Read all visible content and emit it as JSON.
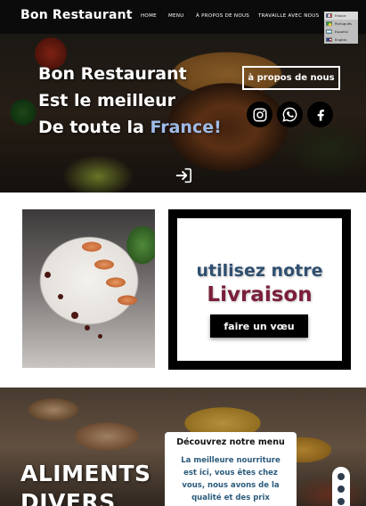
{
  "nav": {
    "brand": "Bon Restaurant",
    "links": [
      "HOME",
      "MENU",
      "À PROPOS DE NOUS",
      "TRAVAILLE AVEC NOUS"
    ],
    "languages": {
      "selected": "France",
      "options": [
        "Português",
        "Español",
        "English"
      ]
    }
  },
  "hero": {
    "line1": "Bon Restaurant",
    "line2": "Est le meilleur",
    "line3_prefix": "De toute la ",
    "line3_accent": "France!",
    "about_button": "à propos de nous",
    "social_icons": [
      "instagram-icon",
      "whatsapp-icon",
      "facebook-icon"
    ],
    "login_icon": "sign-in-icon"
  },
  "delivery": {
    "line1": "utilisez notre",
    "line2": "Livraison",
    "button": "faire un vœu"
  },
  "menu_section": {
    "big_line1": "ALIMENTS",
    "big_line2": "DIVERS",
    "card_title": "Découvrez notre menu",
    "card_text_lines": [
      "La meilleure nourriture",
      "est ici, vous êtes chez",
      "vous, nous avons de la",
      "qualité et des prix"
    ]
  },
  "colors": {
    "accent_blue": "#9fbbe8",
    "delivery_blue": "#2f4f6f",
    "delivery_red": "#7a1f3a",
    "menu_text_blue": "#2b5b7c"
  }
}
